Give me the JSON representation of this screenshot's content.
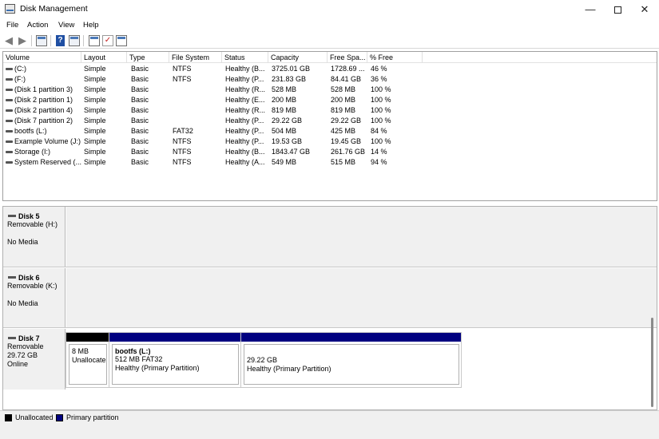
{
  "window": {
    "title": "Disk Management"
  },
  "menu": [
    "File",
    "Action",
    "View",
    "Help"
  ],
  "toolbar": [
    "back-arrow-icon",
    "forward-arrow-icon",
    "console-tree-icon",
    "help-icon",
    "properties-icon",
    "rescan-icon",
    "checklist-icon",
    "list-view-icon"
  ],
  "volumes": {
    "columns": [
      "Volume",
      "Layout",
      "Type",
      "File System",
      "Status",
      "Capacity",
      "Free Spa...",
      "% Free"
    ],
    "rows": [
      [
        "(C:)",
        "Simple",
        "Basic",
        "NTFS",
        "Healthy (B...",
        "3725.01 GB",
        "1728.69 ...",
        "46 %"
      ],
      [
        "(F:)",
        "Simple",
        "Basic",
        "NTFS",
        "Healthy (P...",
        "231.83 GB",
        "84.41 GB",
        "36 %"
      ],
      [
        "(Disk 1 partition 3)",
        "Simple",
        "Basic",
        "",
        "Healthy (R...",
        "528 MB",
        "528 MB",
        "100 %"
      ],
      [
        "(Disk 2 partition 1)",
        "Simple",
        "Basic",
        "",
        "Healthy (E...",
        "200 MB",
        "200 MB",
        "100 %"
      ],
      [
        "(Disk 2 partition 4)",
        "Simple",
        "Basic",
        "",
        "Healthy (R...",
        "819 MB",
        "819 MB",
        "100 %"
      ],
      [
        "(Disk 7 partition 2)",
        "Simple",
        "Basic",
        "",
        "Healthy (P...",
        "29.22 GB",
        "29.22 GB",
        "100 %"
      ],
      [
        "bootfs (L:)",
        "Simple",
        "Basic",
        "FAT32",
        "Healthy (P...",
        "504 MB",
        "425 MB",
        "84 %"
      ],
      [
        "Example Volume (J:)",
        "Simple",
        "Basic",
        "NTFS",
        "Healthy (P...",
        "19.53 GB",
        "19.45 GB",
        "100 %"
      ],
      [
        "Storage (I:)",
        "Simple",
        "Basic",
        "NTFS",
        "Healthy (B...",
        "1843.47 GB",
        "261.76 GB",
        "14 %"
      ],
      [
        "System Reserved (...",
        "Simple",
        "Basic",
        "NTFS",
        "Healthy (A...",
        "549 MB",
        "515 MB",
        "94 %"
      ]
    ]
  },
  "disks": [
    {
      "name": "Disk 5",
      "lines": [
        "Removable (H:)",
        "",
        "No Media"
      ]
    },
    {
      "name": "Disk 6",
      "lines": [
        "Removable (K:)",
        "",
        "No Media"
      ]
    },
    {
      "name": "Disk 7",
      "lines": [
        "Removable",
        "29.72 GB",
        "Online"
      ]
    }
  ],
  "partitions": [
    {
      "title": "",
      "size": "8 MB",
      "status": "Unallocate",
      "color": "#000000"
    },
    {
      "title": "bootfs  (L:)",
      "size": "512 MB FAT32",
      "status": "Healthy (Primary Partition)",
      "color": "#000080"
    },
    {
      "title": "",
      "size": "29.22 GB",
      "status": "Healthy (Primary Partition)",
      "color": "#000080"
    }
  ],
  "legend": [
    {
      "label": "Unallocated",
      "color": "#000000"
    },
    {
      "label": "Primary partition",
      "color": "#000080"
    }
  ]
}
